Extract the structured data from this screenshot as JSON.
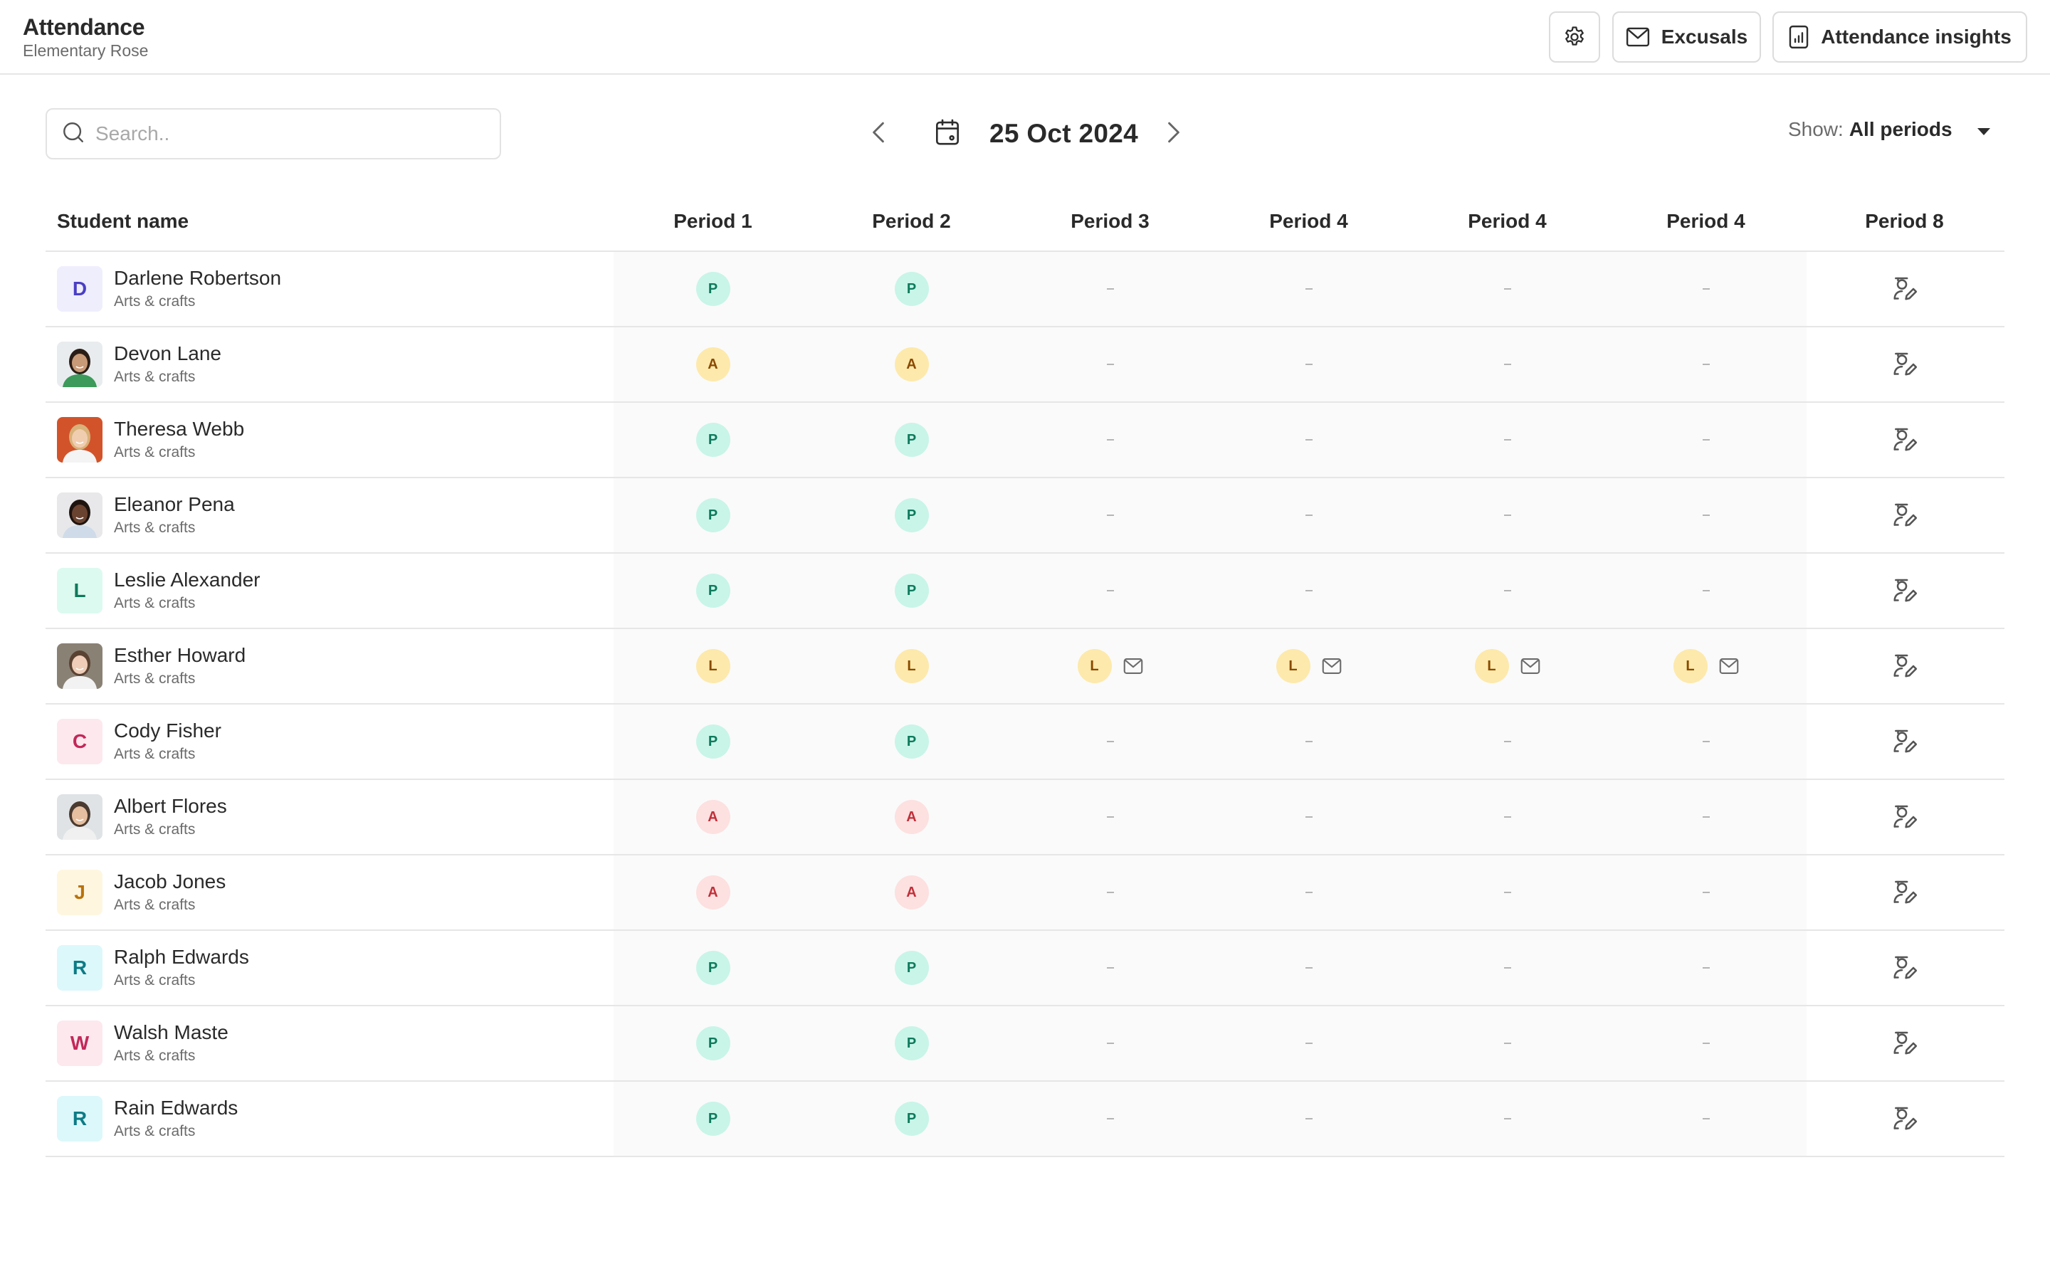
{
  "header": {
    "title": "Attendance",
    "subtitle": "Elementary Rose",
    "buttons": {
      "settings_icon": "gear-icon",
      "excusals_label": "Excusals",
      "excusals_icon": "mail-icon",
      "insights_label": "Attendance insights",
      "insights_icon": "bar-chart-icon"
    }
  },
  "toolbar": {
    "search": {
      "placeholder": "Search..",
      "value": ""
    },
    "date": "25 Oct 2024",
    "show_label": "Show:",
    "show_value": "All periods"
  },
  "table": {
    "columns": [
      "Student name",
      "Period 1",
      "Period 2",
      "Period 3",
      "Period 4",
      "Period 4",
      "Period 4",
      "Period 8"
    ],
    "status_colors": {
      "P": {
        "bg": "#c8f5e8",
        "fg": "#0e7a5c"
      },
      "A_late_excused": {
        "bg": "#fde9ab",
        "fg": "#8a4a00"
      },
      "A_absent": {
        "bg": "#fde0e0",
        "fg": "#c0303a"
      },
      "L": {
        "bg": "#fde9ab",
        "fg": "#8a4a00"
      }
    },
    "rows": [
      {
        "name": "Darlene Robertson",
        "class": "Arts & crafts",
        "avatar": {
          "type": "letter",
          "letter": "D",
          "bg": "#efeefd",
          "fg": "#4a3fc4"
        },
        "periods": [
          {
            "s": "P"
          },
          {
            "s": "P"
          },
          {
            "s": "-"
          },
          {
            "s": "-"
          },
          {
            "s": "-"
          },
          {
            "s": "-"
          }
        ]
      },
      {
        "name": "Devon Lane",
        "class": "Arts & crafts",
        "avatar": {
          "type": "photo"
        },
        "periods": [
          {
            "s": "A",
            "tone": "yellow"
          },
          {
            "s": "A",
            "tone": "yellow"
          },
          {
            "s": "-"
          },
          {
            "s": "-"
          },
          {
            "s": "-"
          },
          {
            "s": "-"
          }
        ]
      },
      {
        "name": "Theresa Webb",
        "class": "Arts & crafts",
        "avatar": {
          "type": "photo"
        },
        "periods": [
          {
            "s": "P"
          },
          {
            "s": "P"
          },
          {
            "s": "-"
          },
          {
            "s": "-"
          },
          {
            "s": "-"
          },
          {
            "s": "-"
          }
        ]
      },
      {
        "name": "Eleanor Pena",
        "class": "Arts & crafts",
        "avatar": {
          "type": "photo"
        },
        "periods": [
          {
            "s": "P"
          },
          {
            "s": "P"
          },
          {
            "s": "-"
          },
          {
            "s": "-"
          },
          {
            "s": "-"
          },
          {
            "s": "-"
          }
        ]
      },
      {
        "name": "Leslie Alexander",
        "class": "Arts & crafts",
        "avatar": {
          "type": "letter",
          "letter": "L",
          "bg": "#dcfaf0",
          "fg": "#0e7a5c"
        },
        "periods": [
          {
            "s": "P"
          },
          {
            "s": "P"
          },
          {
            "s": "-"
          },
          {
            "s": "-"
          },
          {
            "s": "-"
          },
          {
            "s": "-"
          }
        ]
      },
      {
        "name": "Esther Howard",
        "class": "Arts & crafts",
        "avatar": {
          "type": "photo"
        },
        "periods": [
          {
            "s": "L"
          },
          {
            "s": "L"
          },
          {
            "s": "L",
            "mail": true
          },
          {
            "s": "L",
            "mail": true
          },
          {
            "s": "L",
            "mail": true
          },
          {
            "s": "L",
            "mail": true
          }
        ]
      },
      {
        "name": "Cody Fisher",
        "class": "Arts & crafts",
        "avatar": {
          "type": "letter",
          "letter": "C",
          "bg": "#fde8ee",
          "fg": "#c2285a"
        },
        "periods": [
          {
            "s": "P"
          },
          {
            "s": "P"
          },
          {
            "s": "-"
          },
          {
            "s": "-"
          },
          {
            "s": "-"
          },
          {
            "s": "-"
          }
        ]
      },
      {
        "name": "Albert Flores",
        "class": "Arts & crafts",
        "avatar": {
          "type": "photo"
        },
        "periods": [
          {
            "s": "A",
            "tone": "red"
          },
          {
            "s": "A",
            "tone": "red"
          },
          {
            "s": "-"
          },
          {
            "s": "-"
          },
          {
            "s": "-"
          },
          {
            "s": "-"
          }
        ]
      },
      {
        "name": "Jacob Jones",
        "class": "Arts & crafts",
        "avatar": {
          "type": "letter",
          "letter": "J",
          "bg": "#fff6e0",
          "fg": "#b8720a"
        },
        "periods": [
          {
            "s": "A",
            "tone": "red"
          },
          {
            "s": "A",
            "tone": "red"
          },
          {
            "s": "-"
          },
          {
            "s": "-"
          },
          {
            "s": "-"
          },
          {
            "s": "-"
          }
        ]
      },
      {
        "name": "Ralph Edwards",
        "class": "Arts & crafts",
        "avatar": {
          "type": "letter",
          "letter": "R",
          "bg": "#dcf8fa",
          "fg": "#0c7b86"
        },
        "periods": [
          {
            "s": "P"
          },
          {
            "s": "P"
          },
          {
            "s": "-"
          },
          {
            "s": "-"
          },
          {
            "s": "-"
          },
          {
            "s": "-"
          }
        ]
      },
      {
        "name": "Walsh Maste",
        "class": "Arts & crafts",
        "avatar": {
          "type": "letter",
          "letter": "W",
          "bg": "#fde8ee",
          "fg": "#c2285a"
        },
        "periods": [
          {
            "s": "P"
          },
          {
            "s": "P"
          },
          {
            "s": "-"
          },
          {
            "s": "-"
          },
          {
            "s": "-"
          },
          {
            "s": "-"
          }
        ]
      },
      {
        "name": "Rain Edwards",
        "class": "Arts & crafts",
        "avatar": {
          "type": "letter",
          "letter": "R",
          "bg": "#dcf8fa",
          "fg": "#0c7b86"
        },
        "periods": [
          {
            "s": "P"
          },
          {
            "s": "P"
          },
          {
            "s": "-"
          },
          {
            "s": "-"
          },
          {
            "s": "-"
          },
          {
            "s": "-"
          }
        ]
      }
    ],
    "period8_icon": "student-edit-icon"
  }
}
